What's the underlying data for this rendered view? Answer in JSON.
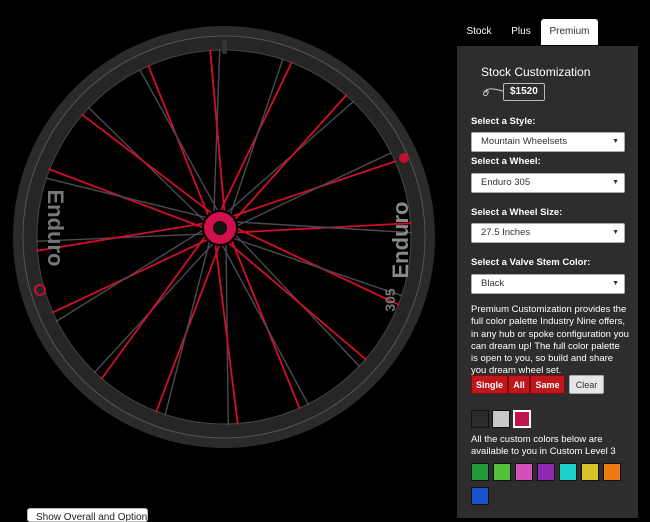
{
  "tabs": [
    {
      "label": "Stock"
    },
    {
      "label": "Plus"
    },
    {
      "label": "Premium",
      "active": true
    }
  ],
  "panel": {
    "title": "Stock Customization",
    "price": "$1520",
    "style_label": "Select a Style:",
    "style_value": "Mountain Wheelsets",
    "wheel_label": "Select a Wheel:",
    "wheel_value": "Enduro 305",
    "size_label": "Select a Wheel Size:",
    "size_value": "27.5 Inches",
    "valve_label": "Select a Valve Stem Color:",
    "valve_value": "Black",
    "description": "Premium Customization provides the full color palette Industry Nine offers, in any hub or spoke configuration you can dream up! The full color palette is open to you, so build and share you dream wheel set.",
    "buttons": {
      "single": "Single",
      "all": "All",
      "same": "Same",
      "clear": "Clear"
    },
    "base_swatches": [
      "#2a2a2e",
      "#c8c8c8",
      "#c4124a"
    ],
    "selected_swatch": 2,
    "custom_note": "All the custom colors below are available to you in Custom Level 3",
    "custom_swatches": [
      "#1f9a3a",
      "#55c03a",
      "#d44fb8",
      "#8e2ab0",
      "#1dd0c8",
      "#d6c22a",
      "#ee7a10",
      "#1f4fd0"
    ]
  },
  "wheel": {
    "rim_text_left": "Enduro",
    "rim_text_right": "Enduro",
    "rim_code": "305",
    "spoke_color": "#d10f2a",
    "alt_spoke_color": "#4a4a55",
    "hub_color": "#d10f4a"
  },
  "bottom_button": "Show Overall and Options"
}
